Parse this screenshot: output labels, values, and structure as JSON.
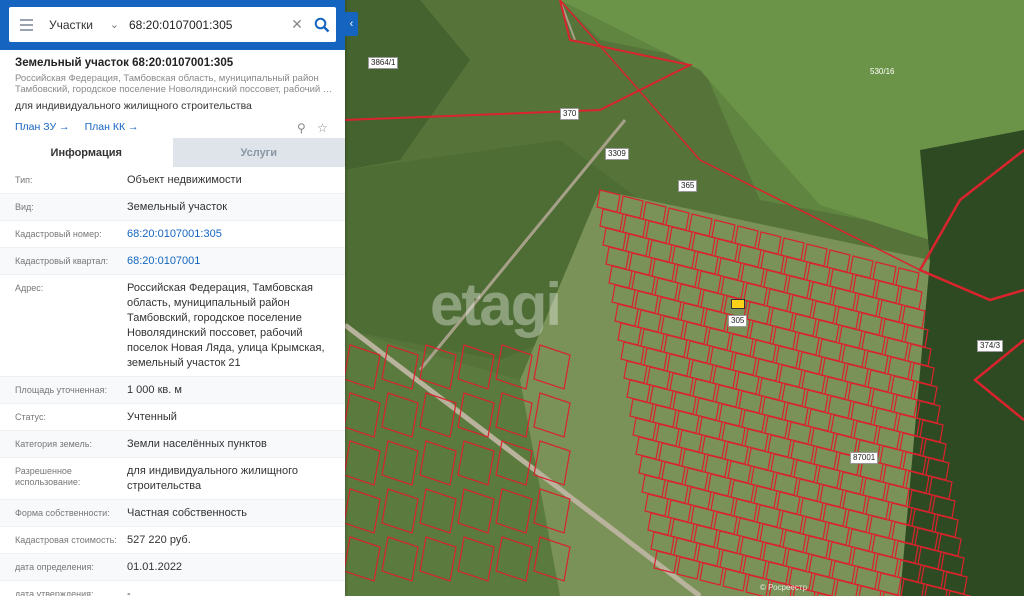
{
  "search": {
    "category": "Участки",
    "value": "68:20:0107001:305"
  },
  "object": {
    "title": "Земельный участок 68:20:0107001:305",
    "address_line1": "Российская Федерация, Тамбовская область, муниципальный район",
    "address_line2": "Тамбовский, городское поселение Новолядинский поссовет, рабочий поселок…",
    "usage": "для индивидуального жилищного строительства",
    "plan_zu": "План ЗУ →",
    "plan_kk": "План КК →"
  },
  "tabs": {
    "info": "Информация",
    "services": "Услуги"
  },
  "rows": [
    {
      "k": "Тип:",
      "v": "Объект недвижимости"
    },
    {
      "k": "Вид:",
      "v": "Земельный участок"
    },
    {
      "k": "Кадастровый номер:",
      "v": "68:20:0107001:305"
    },
    {
      "k": "Кадастровый квартал:",
      "v": "68:20:0107001"
    },
    {
      "k": "Адрес:",
      "v": "Российская Федерация, Тамбовская область, муниципальный район Тамбовский, городское поселение Новолядинский поссовет, рабочий поселок Новая Ляда, улица Крымская, земельный участок 21"
    },
    {
      "k": "Площадь уточненная:",
      "v": "1 000 кв. м"
    },
    {
      "k": "Статус:",
      "v": "Учтенный"
    },
    {
      "k": "Категория земель:",
      "v": "Земли населённых пунктов"
    },
    {
      "k": "Разрешенное использование:",
      "v": "для индивидуального жилищного строительства"
    },
    {
      "k": "Форма собственности:",
      "v": "Частная собственность"
    },
    {
      "k": "Кадастровая стоимость:",
      "v": "527 220 руб."
    },
    {
      "k": "дата определения:",
      "v": "01.01.2022"
    },
    {
      "k": "дата утверждения:",
      "v": "-"
    }
  ],
  "map": {
    "watermark": "etagi",
    "labels": [
      "3864/1",
      "530/16",
      "374/3",
      "370",
      "3309",
      "365",
      "305",
      "87001"
    ],
    "copyright": "© Росреестр"
  },
  "colors": {
    "accent": "#1565c0",
    "parcel_border": "#d9232d",
    "selected": "#ffd21a"
  }
}
